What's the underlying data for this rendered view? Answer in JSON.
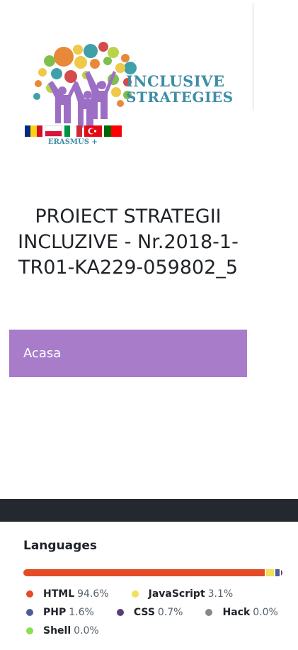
{
  "logo": {
    "title_line1": "INCLUSIVE",
    "title_line2": "STRATEGIES",
    "subtitle": "ERASMUS +"
  },
  "site": {
    "title": "PROIECT STRATEGII INCLUZIVE - Nr.2018-1-TR01-KA229-059802_5"
  },
  "nav": {
    "items": [
      {
        "label": "Acasa"
      }
    ]
  },
  "languages": {
    "heading": "Languages",
    "items": [
      {
        "name": "HTML",
        "percent": "94.6%",
        "value": 94.6,
        "color": "#e34c26"
      },
      {
        "name": "JavaScript",
        "percent": "3.1%",
        "value": 3.1,
        "color": "#f1e05a"
      },
      {
        "name": "PHP",
        "percent": "1.6%",
        "value": 1.6,
        "color": "#4F5D95"
      },
      {
        "name": "CSS",
        "percent": "0.7%",
        "value": 0.7,
        "color": "#563d7c"
      },
      {
        "name": "Hack",
        "percent": "0.0%",
        "value": 0.0,
        "color": "#878787"
      },
      {
        "name": "Shell",
        "percent": "0.0%",
        "value": 0.0,
        "color": "#89e051"
      }
    ]
  },
  "colors": {
    "nav_bg": "#a97cc9",
    "footer_bar": "#24292f",
    "logo_text": "#3f8ea6"
  }
}
